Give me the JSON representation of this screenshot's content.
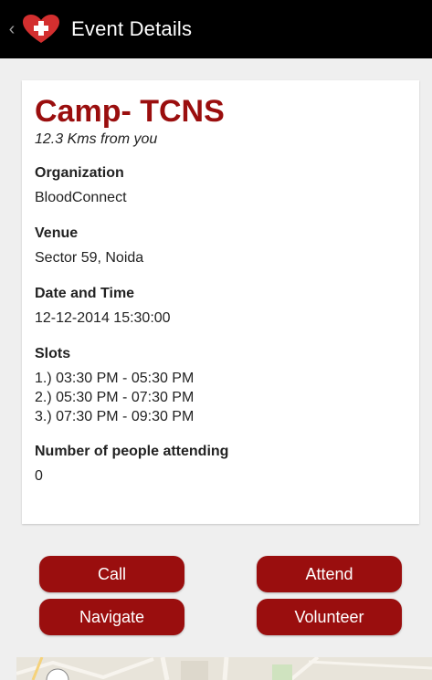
{
  "action_bar": {
    "title": "Event Details",
    "accent_color": "#d32f2f"
  },
  "event": {
    "name": "Camp- TCNS",
    "distance": "12.3 Kms from you",
    "organization_label": "Organization",
    "organization": "BloodConnect",
    "venue_label": "Venue",
    "venue": "Sector 59, Noida",
    "datetime_label": "Date and Time",
    "datetime": "12-12-2014 15:30:00",
    "slots_label": "Slots",
    "slots": [
      "1.) 03:30 PM - 05:30 PM",
      "2.) 05:30 PM - 07:30 PM",
      "3.) 07:30 PM - 09:30 PM"
    ],
    "attending_label": "Number of people attending",
    "attending": "0"
  },
  "buttons": {
    "call": "Call",
    "attend": "Attend",
    "navigate": "Navigate",
    "volunteer": "Volunteer"
  },
  "colors": {
    "primary": "#9a0e0e",
    "background": "#efefef"
  }
}
